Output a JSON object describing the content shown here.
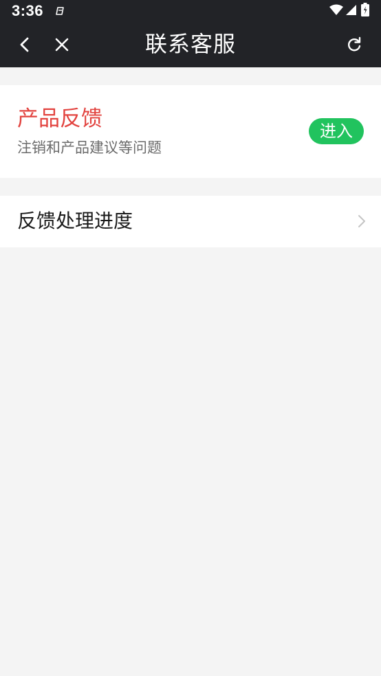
{
  "status_bar": {
    "time": "3:36",
    "icons": [
      "notification-icon",
      "wifi-icon",
      "signal-icon",
      "battery-icon"
    ]
  },
  "nav": {
    "title": "联系客服",
    "back_icon": "chevron-left-icon",
    "close_icon": "close-icon",
    "refresh_icon": "refresh-icon"
  },
  "feedback_card": {
    "title": "产品反馈",
    "subtitle": "注销和产品建议等问题",
    "button_label": "进入"
  },
  "progress_row": {
    "label": "反馈处理进度",
    "icon": "chevron-right-icon"
  },
  "colors": {
    "header_bg": "#222327",
    "page_bg": "#f4f4f4",
    "accent_red": "#e2423e",
    "accent_green": "#21c35e"
  }
}
